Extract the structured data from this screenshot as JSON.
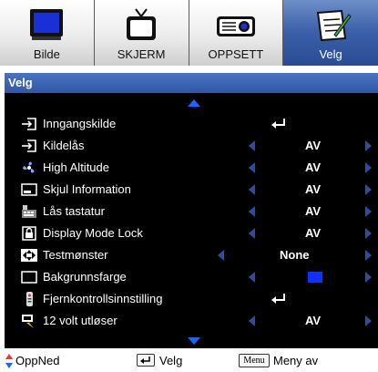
{
  "tabs": [
    {
      "label": "Bilde",
      "icon": "monitor-icon",
      "active": false
    },
    {
      "label": "SKJERM",
      "icon": "tv-icon",
      "active": false
    },
    {
      "label": "OPPSETT",
      "icon": "projector-icon",
      "active": false
    },
    {
      "label": "Velg",
      "icon": "notepad-icon",
      "active": true
    }
  ],
  "section_title": "Velg",
  "rows": [
    {
      "label": "Inngangskilde",
      "icon": "input-icon",
      "control": "enter"
    },
    {
      "label": "Kildelås",
      "icon": "source-lock-icon",
      "value": "AV"
    },
    {
      "label": "High Altitude",
      "icon": "fan-icon",
      "value": "AV"
    },
    {
      "label": "Skjul Information",
      "icon": "hide-info-icon",
      "value": "AV"
    },
    {
      "label": "Lås tastatur",
      "icon": "keypad-lock-icon",
      "value": "AV"
    },
    {
      "label": "Display Mode Lock",
      "icon": "display-mode-lock-icon",
      "value": "AV"
    },
    {
      "label": "Testmønster",
      "icon": "test-pattern-icon",
      "value": "None"
    },
    {
      "label": "Bakgrunnsfarge",
      "icon": "background-color-icon",
      "control": "swatch",
      "swatch_color": "#1030ff"
    },
    {
      "label": "Fjernkontrollsinnstilling",
      "icon": "remote-icon",
      "control": "enter"
    },
    {
      "label": "12 volt utløser",
      "icon": "twelve-volt-icon",
      "value": "AV"
    }
  ],
  "footer": {
    "nav_label": "OppNed",
    "enter_label": "Velg",
    "menu_key": "Menu",
    "menu_label": "Meny av"
  },
  "colors": {
    "accent": "#2f57a4",
    "arrow_blue": "#2a4fa0",
    "scroll_blue": "#1e63ff",
    "nav_red": "#ff3030"
  }
}
